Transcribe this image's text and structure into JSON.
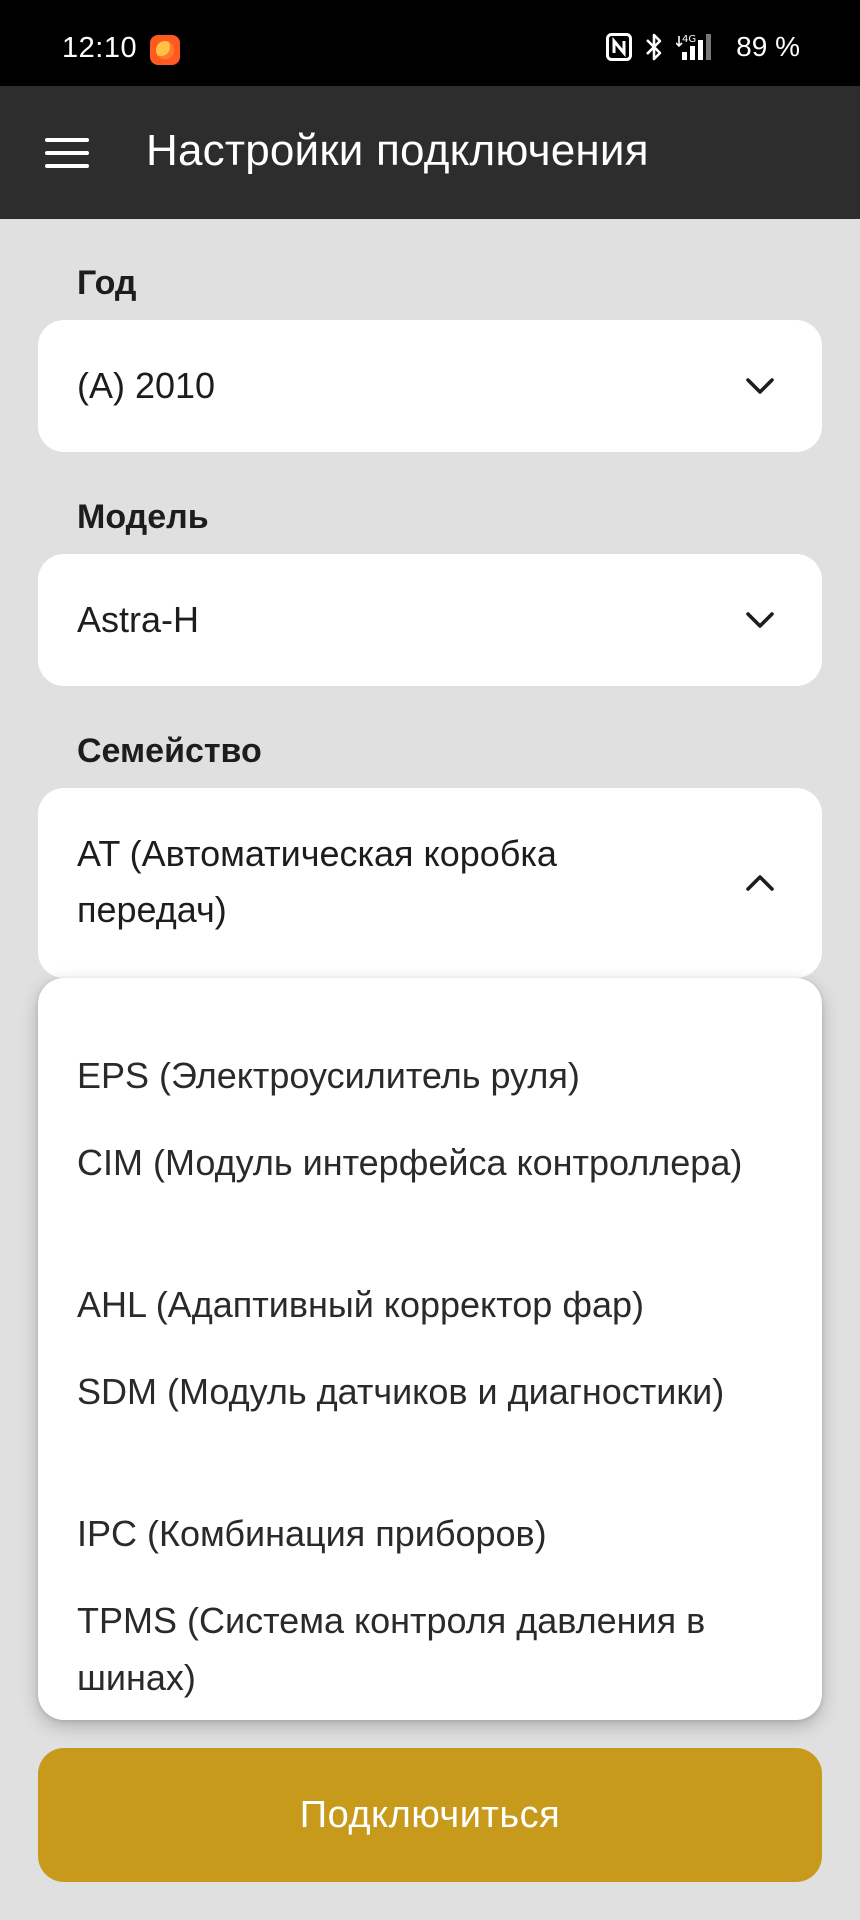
{
  "status_bar": {
    "time": "12:10",
    "battery": "89 %",
    "network": "4G",
    "icons": [
      "notification-app-icon",
      "nfc-icon",
      "bluetooth-icon",
      "signal-icon",
      "battery-text"
    ]
  },
  "app_bar": {
    "title": "Настройки подключения",
    "menu_icon": "hamburger-menu-icon"
  },
  "form": {
    "year": {
      "label": "Год",
      "value": "(A) 2010"
    },
    "model": {
      "label": "Модель",
      "value": "Astra-H"
    },
    "family": {
      "label": "Семейство",
      "value": "AT (Автоматическая коробка передач)",
      "expanded": true
    }
  },
  "dropdown": {
    "partially_visible_item": "",
    "options": [
      "EPS (Электроусилитель руля)",
      "CIM (Модуль интерфейса контроллера)",
      "AHL (Адаптивный корректор фар)",
      "SDM (Модуль датчиков и диагностики)",
      "IPC (Комбинация приборов)",
      "TPMS (Система контроля давления в шинах)"
    ]
  },
  "actions": {
    "connect_label": "Подключиться"
  },
  "colors": {
    "status_bar": "#000000",
    "app_bar": "#2d2d2d",
    "background": "#e0e0e0",
    "card": "#ffffff",
    "accent": "#c79a1c"
  }
}
